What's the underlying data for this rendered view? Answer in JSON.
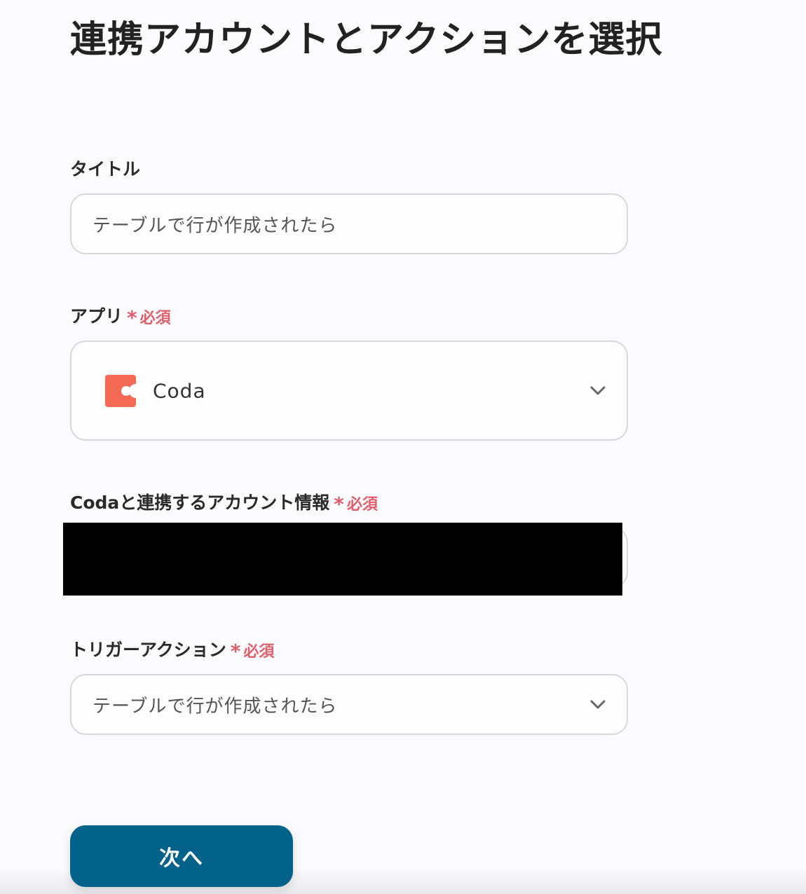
{
  "page": {
    "title": "連携アカウントとアクションを選択"
  },
  "form": {
    "title_field": {
      "label": "タイトル",
      "value": "テーブルで行が作成されたら"
    },
    "app_field": {
      "label": "アプリ",
      "required_mark": "*",
      "required_text": "必須",
      "selected_app": "Coda",
      "selected_app_icon": "coda-logo-icon"
    },
    "account_field": {
      "label": "Codaと連携するアカウント情報",
      "required_mark": "*",
      "required_text": "必須"
    },
    "trigger_field": {
      "label": "トリガーアクション",
      "required_mark": "*",
      "required_text": "必須",
      "value": "テーブルで行が作成されたら"
    }
  },
  "actions": {
    "next_label": "次へ"
  },
  "colors": {
    "primary_button": "#03628a",
    "required": "#e35d6a",
    "coda_brand": "#f46a54"
  }
}
